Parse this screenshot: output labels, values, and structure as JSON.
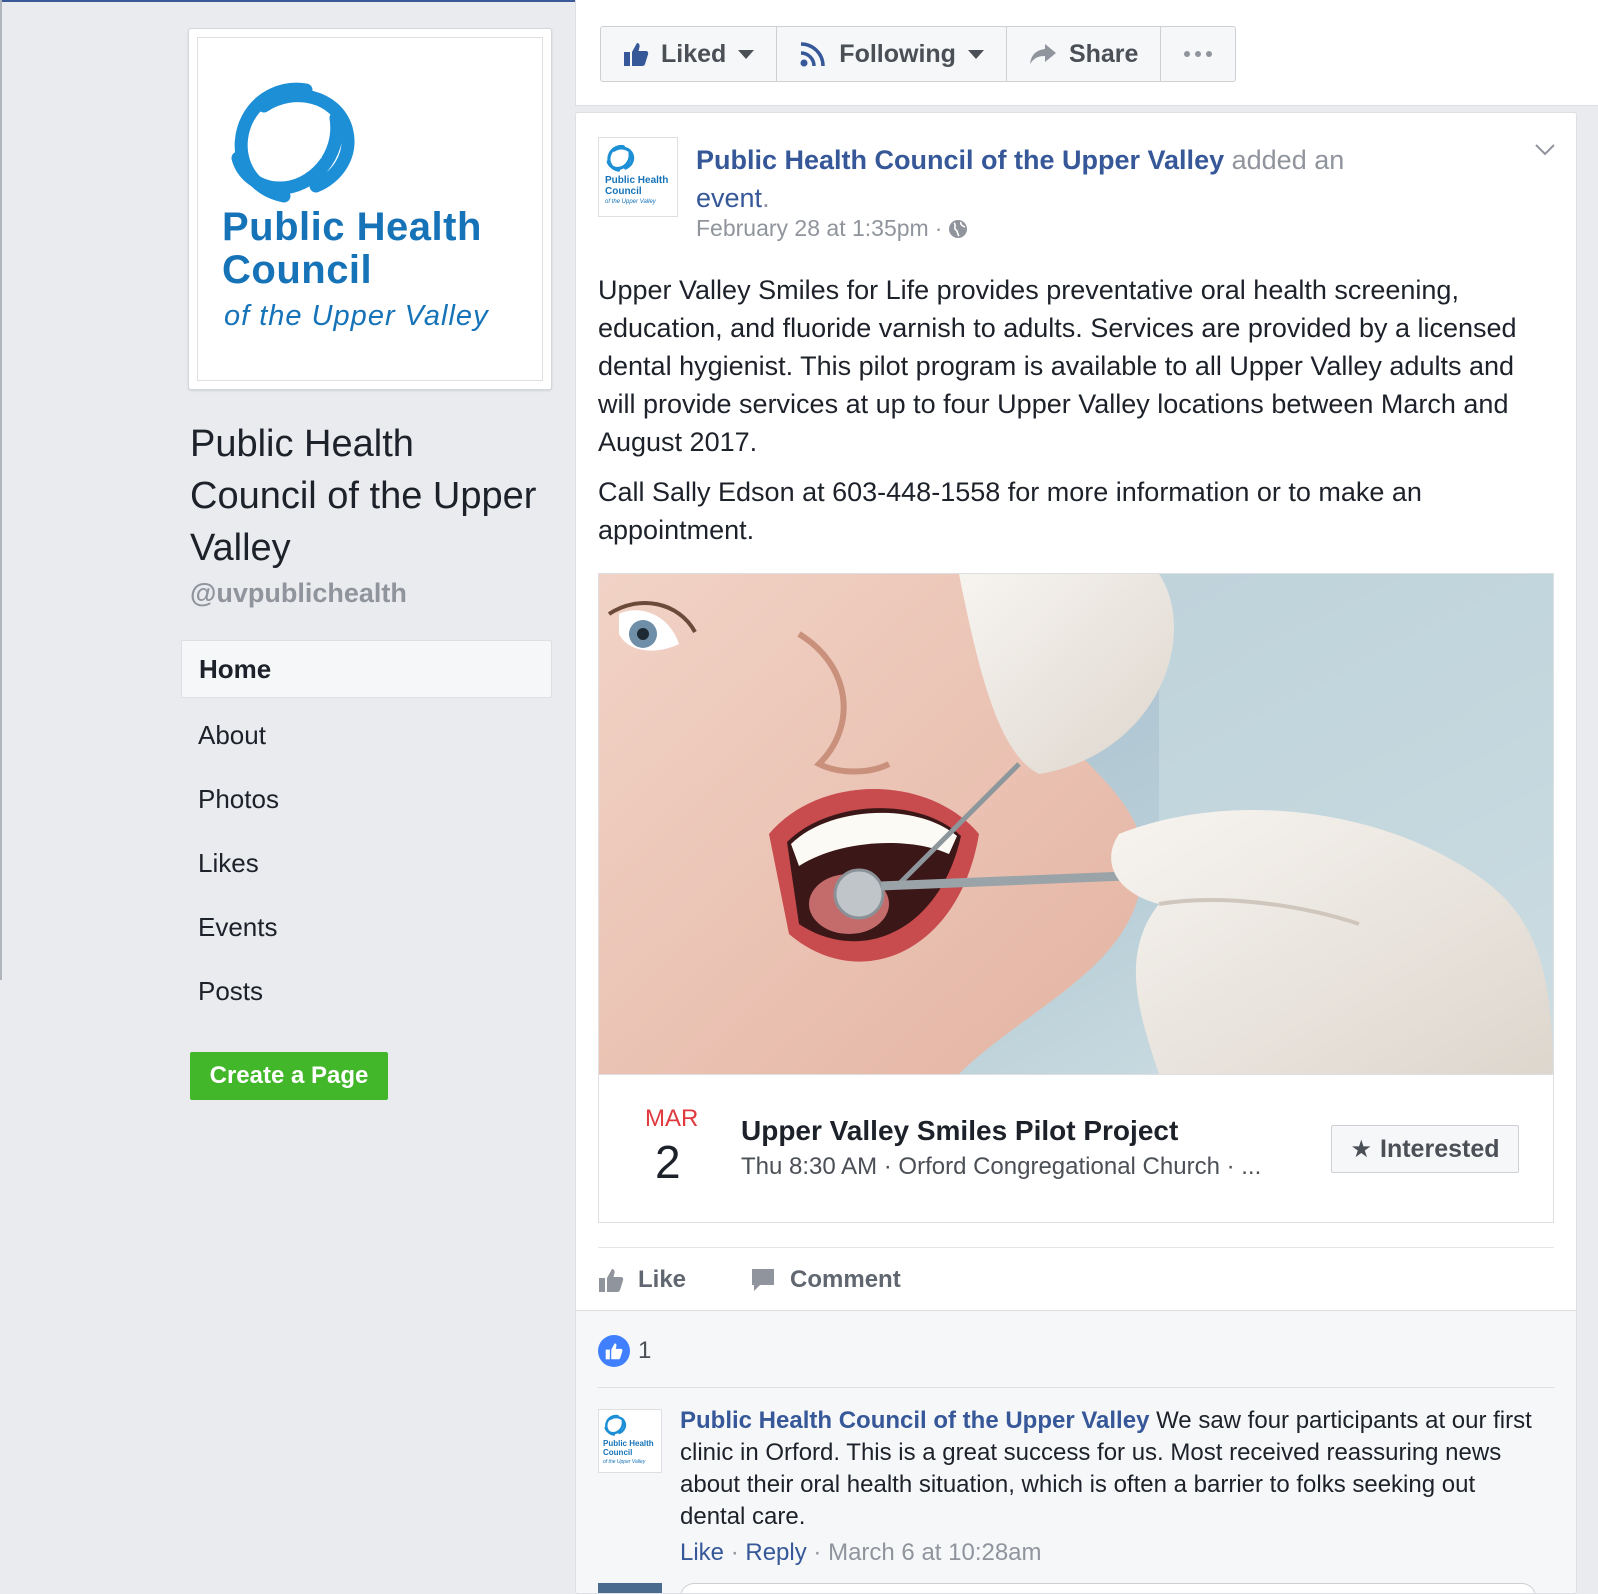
{
  "brand": {
    "blue": "#365899",
    "logo_blue": "#1673b8",
    "green": "#42b72a"
  },
  "profile": {
    "logo_line1": "Public Health",
    "logo_line2": "Council",
    "logo_line3": "of the Upper Valley",
    "page_name": "Public Health Council of the Upper Valley",
    "handle": "@uvpublichealth"
  },
  "nav": {
    "items": [
      {
        "label": "Home",
        "active": true
      },
      {
        "label": "About"
      },
      {
        "label": "Photos"
      },
      {
        "label": "Likes"
      },
      {
        "label": "Events"
      },
      {
        "label": "Posts"
      }
    ],
    "create_page": "Create a Page"
  },
  "actions": {
    "liked": "Liked",
    "following": "Following",
    "share": "Share",
    "more_icon": "ellipsis-icon"
  },
  "post": {
    "author": "Public Health Council of the Upper Valley",
    "verb": "added an",
    "object": "event",
    "timestamp": "February 28 at 1:35pm",
    "privacy_icon": "globe-icon",
    "paragraph1": "Upper Valley Smiles for Life provides preventative oral health screening, education, and fluoride varnish to adults. Services are provided by a licensed dental hygienist. This pilot program is available to all Upper Valley adults and will provide services at up to four Upper Valley locations between March and August 2017.",
    "paragraph2": "Call Sally Edson at 603-448-1558 for more information or to make an appointment.",
    "avatar_line1": "Public Health",
    "avatar_line2": "Council",
    "avatar_line3": "of the Upper Valley"
  },
  "event": {
    "month": "MAR",
    "day": "2",
    "title": "Upper Valley Smiles Pilot Project",
    "details": "Thu 8:30 AM · Orford Congregational Church · ...",
    "interested": "Interested"
  },
  "post_actions": {
    "like": "Like",
    "comment": "Comment"
  },
  "feedback": {
    "like_count": "1",
    "comment": {
      "author": "Public Health Council of the Upper Valley",
      "text": " We saw four participants at our first clinic in Orford. This is a great success for us. Most received reassuring news about their oral health situation, which is often a barrier to folks seeking out dental care.",
      "like": "Like",
      "reply": "Reply",
      "time": "March 6 at 10:28am"
    }
  }
}
